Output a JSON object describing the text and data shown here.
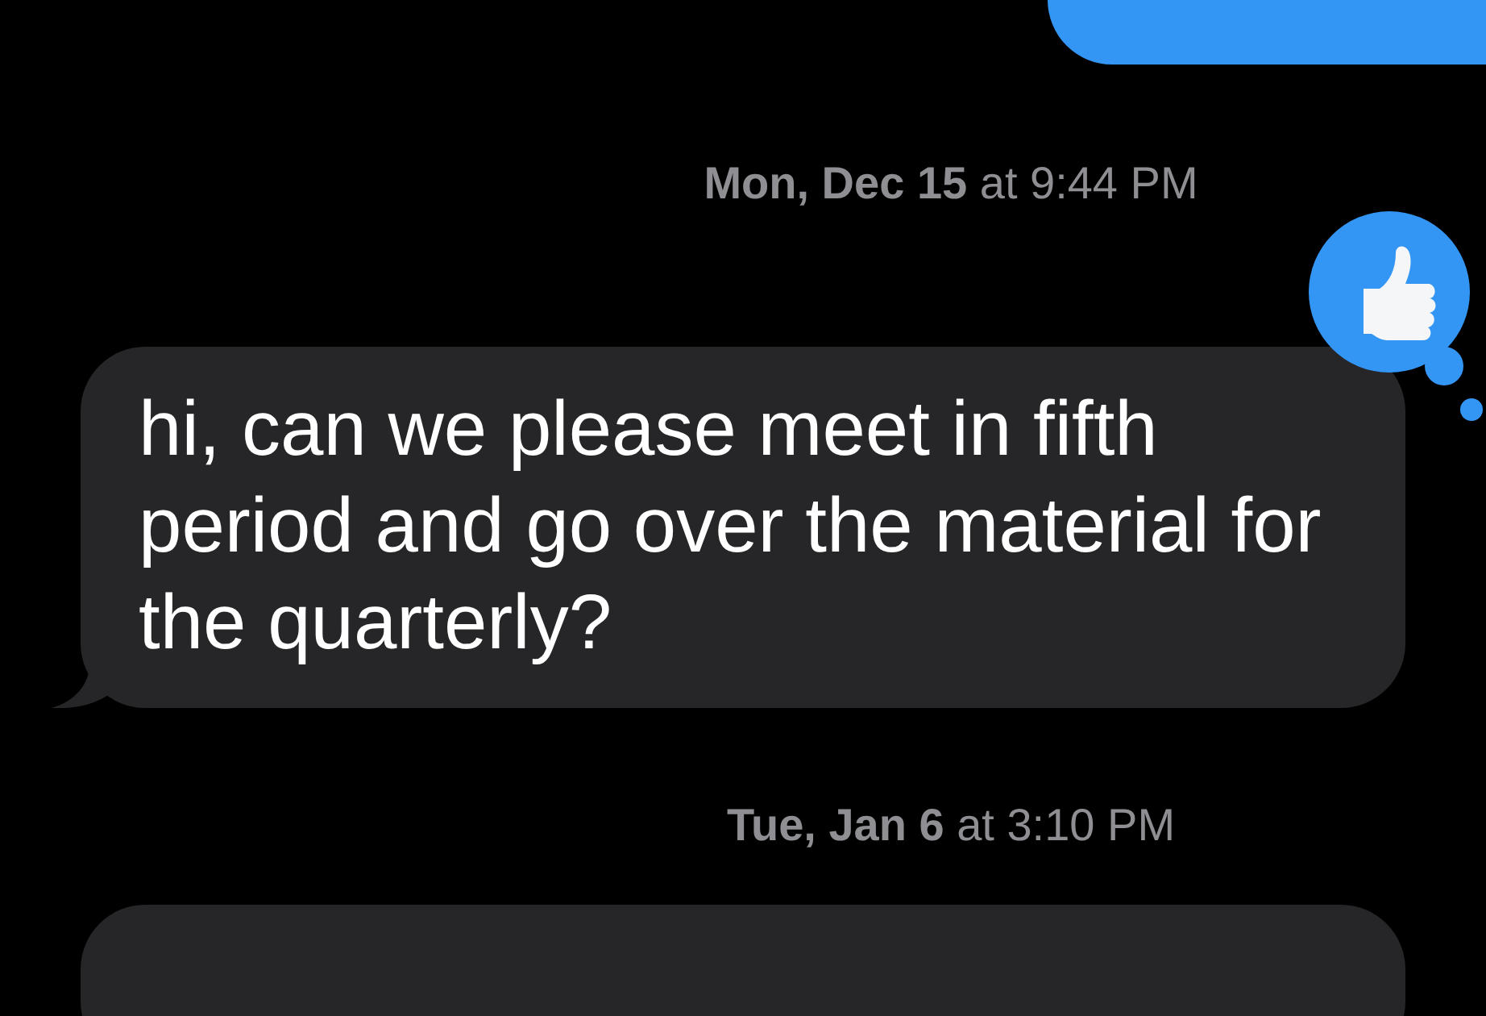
{
  "messages": [
    {
      "kind": "sent_bubble"
    },
    {
      "kind": "timestamp",
      "text": "**Mon, Dec 15** at 9:44 PM"
    },
    {
      "kind": "received_bubble",
      "text": "hi, can we please meet in fifth period and go over the material for the quarterly?",
      "reacted": true
    },
    {
      "kind": "timestamp",
      "text": "**Tue, Jan 6** at 3:10 PM"
    },
    {
      "kind": "received_bubble"
    }
  ]
}
